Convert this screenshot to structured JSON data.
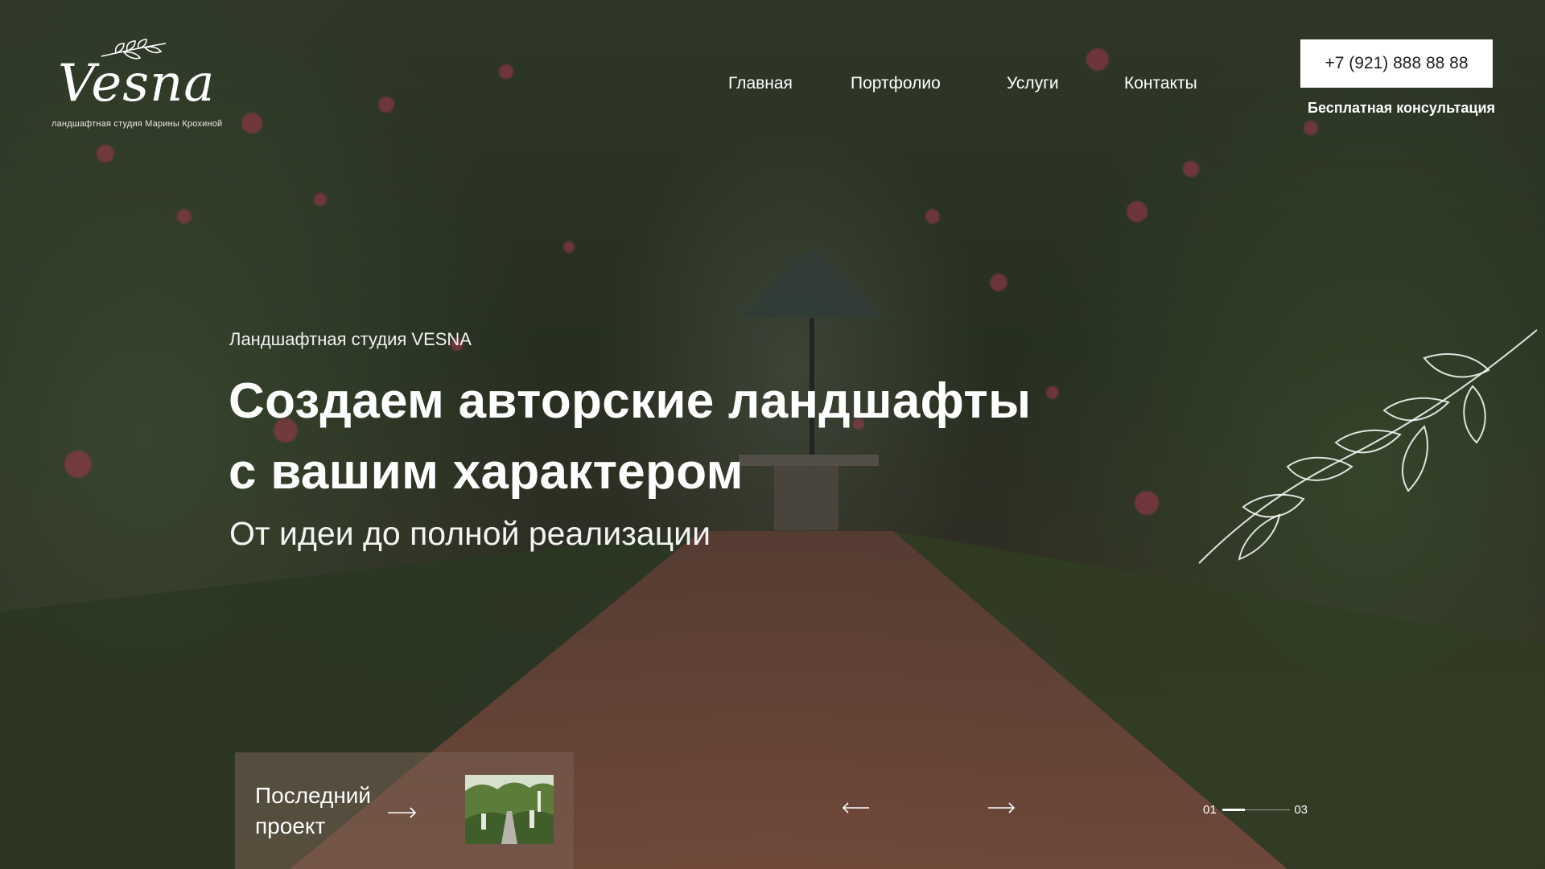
{
  "logo": {
    "wordmark": "Vesna",
    "tagline": "ландшафтная студия Марины Крохиной"
  },
  "nav": {
    "items": [
      {
        "label": "Главная"
      },
      {
        "label": "Портфолио"
      },
      {
        "label": "Услуги"
      },
      {
        "label": "Контакты"
      }
    ]
  },
  "contact": {
    "phone": "+7 (921) 888 88 88",
    "consultation": "Бесплатная консультация"
  },
  "hero": {
    "kicker": "Ландшафтная студия VESNA",
    "headline_line1": "Создаем авторские ландшафты",
    "headline_line2": "с вашим характером",
    "subheadline": "От идеи до полной реализации"
  },
  "latest_project": {
    "label": "Последний проект"
  },
  "slider": {
    "current": "01",
    "total": "03",
    "progress": 0.33
  },
  "icons": {
    "prev": "arrow-left-icon",
    "next": "arrow-right-icon",
    "card_arrow": "arrow-right-icon",
    "logo_sprig": "leaf-sprig-icon"
  },
  "colors": {
    "phone_button_bg": "#ffffff",
    "phone_button_text": "#222222",
    "card_bg": "#78604c"
  }
}
